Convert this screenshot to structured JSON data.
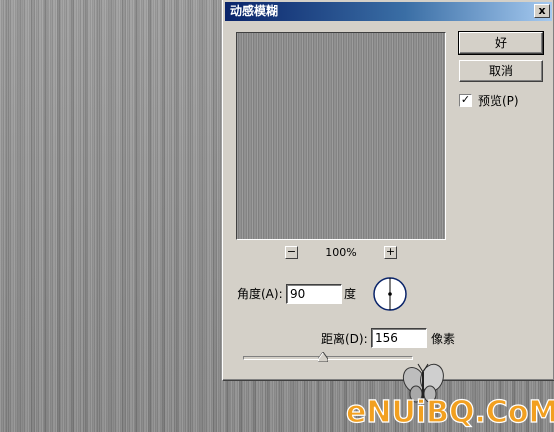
{
  "dialog": {
    "title": "动感模糊",
    "close_glyph": "x",
    "ok_label": "好",
    "cancel_label": "取消",
    "preview_label": "预览(P)",
    "preview_checked": true,
    "check_glyph": "✓",
    "zoom_out_glyph": "−",
    "zoom_in_glyph": "+",
    "zoom_level": "100%",
    "angle_label": "角度(A):",
    "angle_value": "90",
    "angle_unit": "度",
    "distance_label": "距离(D):",
    "distance_value": "156",
    "distance_unit": "像素",
    "distance_slider_fraction": 0.47
  },
  "watermark": {
    "text": "eNUiBQ.CoM"
  },
  "colors": {
    "dialog_face": "#d4d0c8",
    "title_bar_start": "#0a246a",
    "title_bar_end": "#a6caf0",
    "brushed_metal": "#8b8b8b",
    "watermark_accent": "#f2a020"
  },
  "icons": {
    "dial": "angle-dial-icon",
    "thumb": "slider-thumb-icon",
    "butterfly": "butterfly-icon"
  }
}
